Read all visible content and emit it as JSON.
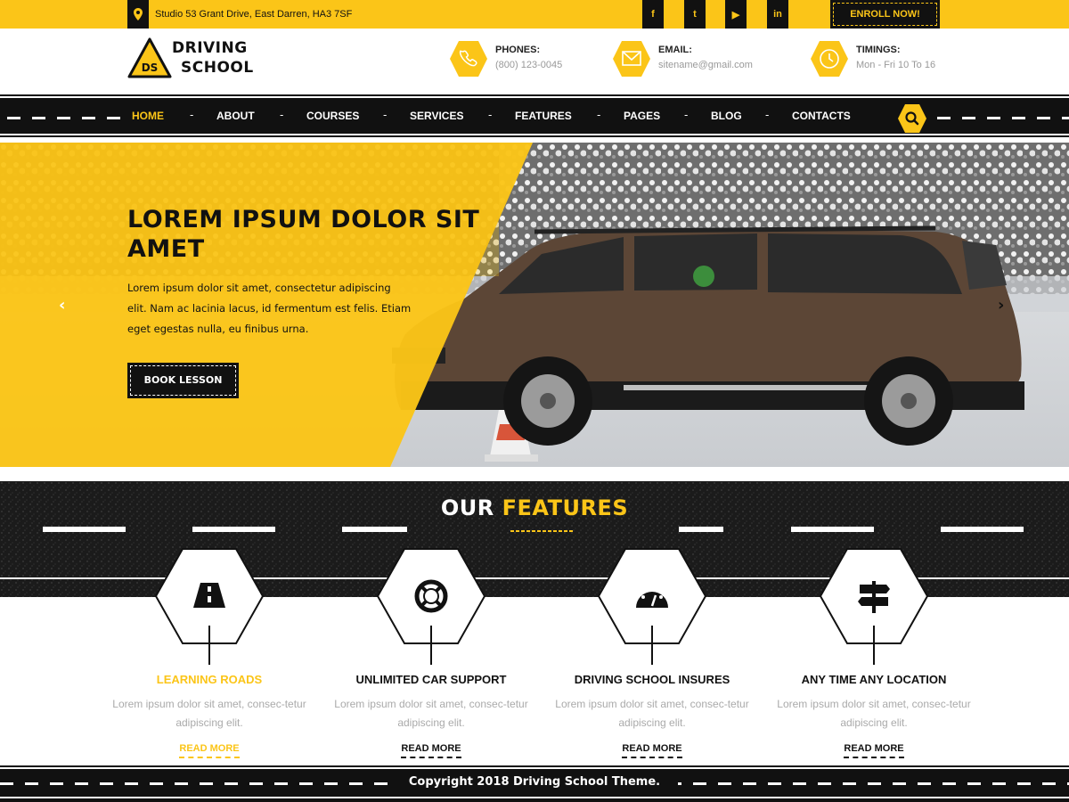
{
  "topbar": {
    "address": "Studio 53 Grant Drive, East Darren, HA3 7SF",
    "social": [
      {
        "label": "f",
        "icon": "facebook-icon"
      },
      {
        "label": "t",
        "icon": "twitter-icon"
      },
      {
        "label": "▶",
        "icon": "youtube-icon"
      },
      {
        "label": "in",
        "icon": "linkedin-icon"
      }
    ],
    "enroll_label": "ENROLL NOW!"
  },
  "header": {
    "logo_badge": "DS",
    "logo_line1": "DRIVING",
    "logo_line2": "SCHOOL",
    "contacts": [
      {
        "label": "PHONES:",
        "value": "(800) 123-0045",
        "icon": "phone-icon"
      },
      {
        "label": "EMAIL:",
        "value": "sitename@gmail.com",
        "icon": "envelope-icon"
      },
      {
        "label": "TIMINGS:",
        "value": "Mon - Fri 10 To 16",
        "icon": "clock-icon"
      }
    ]
  },
  "nav": {
    "items": [
      "HOME",
      "ABOUT",
      "COURSES",
      "SERVICES",
      "FEATURES",
      "PAGES",
      "BLOG",
      "CONTACTS"
    ],
    "active": "HOME"
  },
  "hero": {
    "title": "LOREM IPSUM DOLOR SIT AMET",
    "description": "Lorem ipsum dolor sit amet, consectetur adipiscing elit. Nam ac lacinia lacus, id fermentum est felis. Etiam eget egestas nulla, eu finibus urna.",
    "button_label": "BOOK LESSON",
    "prev_arrow": "‹",
    "next_arrow": "›"
  },
  "features": {
    "title_white": "OUR",
    "title_yellow": "FEATURES",
    "items": [
      {
        "title": "LEARNING ROADS",
        "desc": "Lorem ipsum dolor sit amet, consec-tetur adipiscing elit.",
        "more": "READ MORE",
        "icon": "road-icon",
        "highlight": true
      },
      {
        "title": "UNLIMITED CAR SUPPORT",
        "desc": "Lorem ipsum dolor sit amet, consec-tetur adipiscing elit.",
        "more": "READ MORE",
        "icon": "lifebuoy-icon",
        "highlight": false
      },
      {
        "title": "DRIVING SCHOOL INSURES",
        "desc": "Lorem ipsum dolor sit amet, consec-tetur adipiscing elit.",
        "more": "READ MORE",
        "icon": "speedometer-icon",
        "highlight": false
      },
      {
        "title": "ANY TIME ANY LOCATION",
        "desc": "Lorem ipsum dolor sit amet, consec-tetur adipiscing elit.",
        "more": "READ MORE",
        "icon": "signpost-icon",
        "highlight": false
      }
    ]
  },
  "footer": {
    "copyright": "Copyright 2018 Driving School Theme."
  },
  "colors": {
    "accent": "#fbc518",
    "dark": "#111111"
  }
}
